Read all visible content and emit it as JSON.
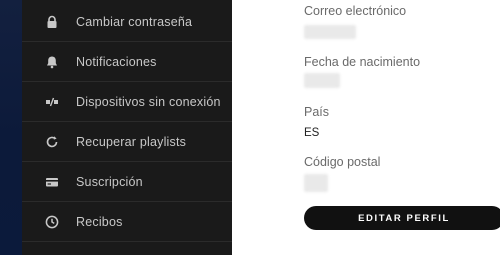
{
  "colors": {
    "sidebar_bg": "#1a1a1a",
    "sidebar_text": "#c8c8c8",
    "divider": "#2b2b2b",
    "button_bg": "#111111"
  },
  "sidebar": {
    "items": [
      {
        "label": "Cambiar contraseña",
        "icon": "lock-icon"
      },
      {
        "label": "Notificaciones",
        "icon": "bell-icon"
      },
      {
        "label": "Dispositivos sin conexión",
        "icon": "offline-devices-icon"
      },
      {
        "label": "Recuperar playlists",
        "icon": "refresh-icon"
      },
      {
        "label": "Suscripción",
        "icon": "credit-card-icon"
      },
      {
        "label": "Recibos",
        "icon": "clock-icon"
      }
    ]
  },
  "profile": {
    "email_label": "Correo electrónico",
    "birthdate_label": "Fecha de nacimiento",
    "country_label": "País",
    "country_value": "ES",
    "postal_label": "Código postal",
    "edit_button": "EDITAR PERFIL"
  }
}
